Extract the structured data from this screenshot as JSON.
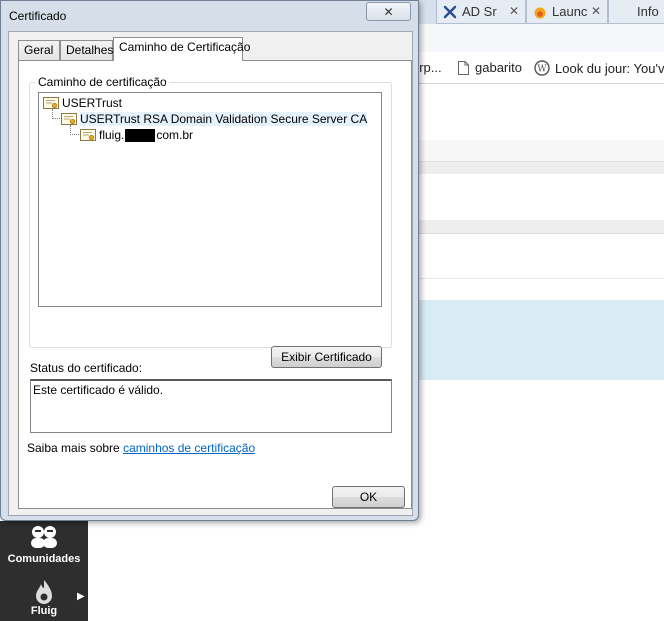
{
  "browser": {
    "tabs": [
      {
        "label": "AD Sr",
        "icon": "tools-icon"
      },
      {
        "label": "Launc",
        "icon": "flame-icon"
      },
      {
        "label": "Info",
        "icon": ""
      }
    ],
    "bookmarks": [
      {
        "label": "erp...",
        "icon": ""
      },
      {
        "label": "gabarito",
        "icon": "page-icon"
      },
      {
        "label": "Look du jour: You've",
        "icon": "wordpress-icon"
      }
    ],
    "sidebar": [
      {
        "label": "Comunidades",
        "icon": "people-icon"
      },
      {
        "label": "Fluig",
        "icon": "fluig-flame-icon"
      }
    ]
  },
  "dialog": {
    "title": "Certificado",
    "close_glyph": "✕",
    "tabs": [
      {
        "label": "Geral"
      },
      {
        "label": "Detalhes"
      },
      {
        "label": "Caminho de Certificação"
      }
    ],
    "path_group_label": "Caminho de certificação",
    "path": [
      {
        "label": "USERTrust"
      },
      {
        "label": "USERTrust RSA Domain Validation Secure Server CA"
      },
      {
        "label_prefix": "fluig.",
        "label_suffix": "com.br"
      }
    ],
    "view_cert_button": "Exibir Certificado",
    "status_label": "Status do certificado:",
    "status_text": "Este certificado é válido.",
    "learn_prefix": "Saiba mais sobre",
    "learn_link": "caminhos de certificação",
    "ok_button": "OK"
  },
  "colors": {
    "link": "#0066cc",
    "dialog_frame": "#d6dfe9",
    "highlight_band": "#d9ecf5"
  }
}
